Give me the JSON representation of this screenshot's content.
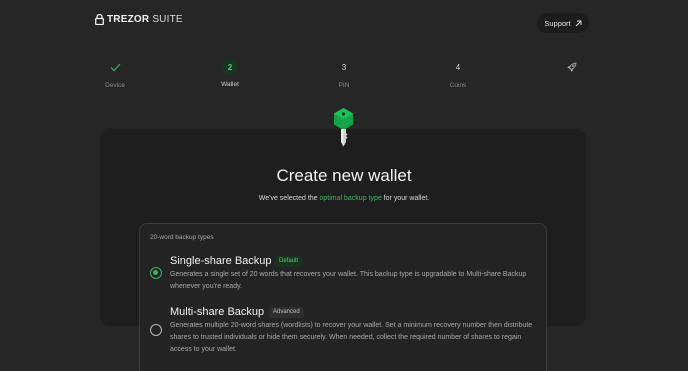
{
  "header": {
    "logo_brand": "TREZOR",
    "logo_suite": "SUITE",
    "support_label": "Support"
  },
  "stepper": {
    "steps": [
      {
        "label": "Device",
        "marker": "",
        "state": "done"
      },
      {
        "label": "Wallet",
        "marker": "2",
        "state": "active"
      },
      {
        "label": "PIN",
        "marker": "3",
        "state": "pending"
      },
      {
        "label": "Coins",
        "marker": "4",
        "state": "pending"
      },
      {
        "label": "",
        "marker": "",
        "state": "final"
      }
    ]
  },
  "main": {
    "title": "Create new wallet",
    "subtitle_before": "We've selected the ",
    "subtitle_link": "optimal backup type",
    "subtitle_after": " for your wallet."
  },
  "backup": {
    "heading": "20-word backup types",
    "options": [
      {
        "title": "Single-share Backup",
        "badge": "Default",
        "selected": true,
        "description": "Generates a single set of 20 words that recovers your wallet. This backup type is upgradable to Multi-share Backup whenever you're ready."
      },
      {
        "title": "Multi-share Backup",
        "badge": "Advanced",
        "selected": false,
        "description": "Generates multiple 20-word shares (wordlists) to recover your wallet. Set a minimum recovery number then distribute shares to trusted individuals or hide them securely. When needed, collect the required number of shares to regain access to your wallet."
      }
    ]
  },
  "colors": {
    "accent": "#3fb463",
    "key_head": "#17a34a",
    "background": "#262626",
    "card": "#1e1e1e"
  },
  "icons": {
    "logo": "lock-icon",
    "support": "arrow-up-right-icon",
    "step_done": "check-icon",
    "step_final": "rocket-icon",
    "hero": "key-icon"
  }
}
